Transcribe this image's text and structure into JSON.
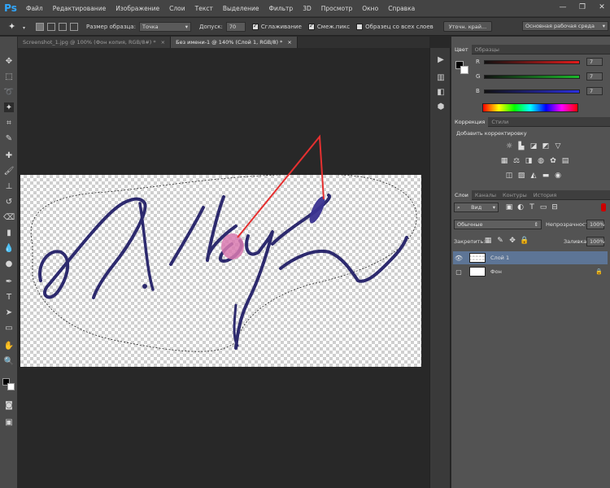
{
  "app": {
    "logo": "Ps",
    "menu": [
      "Файл",
      "Редактирование",
      "Изображение",
      "Слои",
      "Текст",
      "Выделение",
      "Фильтр",
      "3D",
      "Просмотр",
      "Окно",
      "Справка"
    ],
    "window_controls": [
      "—",
      "❐",
      "✕"
    ]
  },
  "options": {
    "sample_size_label": "Размер образца:",
    "sample_size_value": "Точка",
    "tolerance_label": "Допуск:",
    "tolerance_value": "70",
    "antialias_label": "Сглаживание",
    "contiguous_label": "Смеж.пикс",
    "all_layers_label": "Образец со всех слоев",
    "refine_label": "Уточн. край...",
    "workspace_value": "Основная рабочая среда"
  },
  "tabs": [
    {
      "label": "Screenshot_1.jpg @ 100% (Фон копия, RGB/8#) *",
      "close": "×"
    },
    {
      "label": "Без имени-1 @ 140% (Слой 1, RGB/8) *",
      "close": "×"
    }
  ],
  "color_panel": {
    "tabs": [
      "Цвет",
      "Образцы"
    ],
    "r_label": "R",
    "g_label": "G",
    "b_label": "B",
    "r_value": "7",
    "g_value": "7",
    "b_value": "7",
    "r_color": "#e21b1b",
    "g_color": "#1bb82a",
    "b_color": "#2b2fe0"
  },
  "adjust_panel": {
    "tabs": [
      "Коррекция",
      "Стили"
    ],
    "title": "Добавить корректировку"
  },
  "layers_panel": {
    "tabs": [
      "Слои",
      "Каналы",
      "Контуры",
      "История"
    ],
    "filter_value": "Вид",
    "blend_value": "Обычные",
    "opacity_label": "Непрозрачность:",
    "opacity_value": "100%",
    "lock_label": "Закрепить:",
    "fill_label": "Заливка:",
    "fill_value": "100%",
    "layers": [
      {
        "name": "Слой 1",
        "selected": true
      },
      {
        "name": "Фон",
        "selected": false
      }
    ]
  },
  "colors": {
    "accent": "#31a8ff",
    "ink": "#2d2a6e",
    "annotation": "#e53030",
    "selected_layer": "#5d7596"
  }
}
